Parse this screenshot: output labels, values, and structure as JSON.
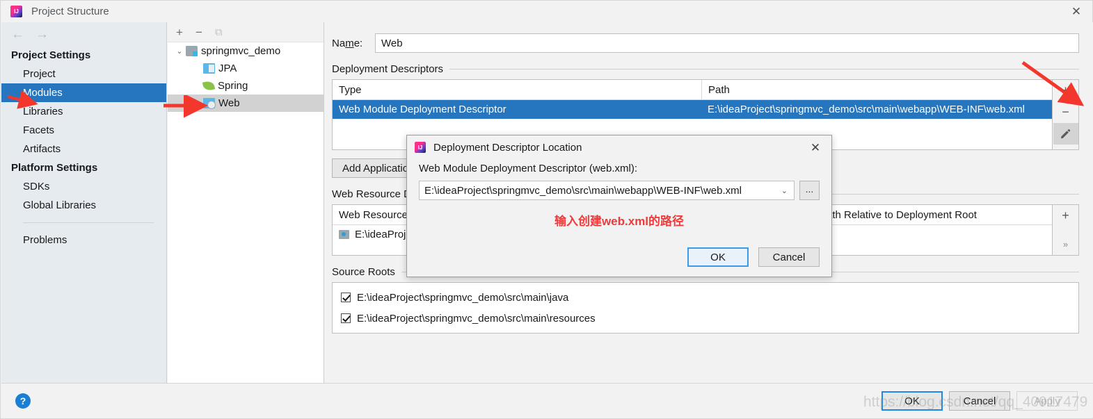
{
  "window": {
    "title": "Project Structure",
    "close_label": "✕",
    "app_icon": "intellij-idea-icon"
  },
  "sidebar": {
    "back_label": "←",
    "forward_label": "→",
    "groups": [
      {
        "label": "Project Settings",
        "items": [
          "Project",
          "Modules",
          "Libraries",
          "Facets",
          "Artifacts"
        ]
      },
      {
        "label": "Platform Settings",
        "items": [
          "SDKs",
          "Global Libraries"
        ]
      }
    ],
    "selected": "Modules",
    "problems_label": "Problems"
  },
  "tree_panel": {
    "toolbar": {
      "add": "+",
      "remove": "−",
      "copy": "⧉"
    },
    "nodes": [
      {
        "label": "springmvc_demo",
        "icon": "module-folder-icon",
        "indent": 0,
        "twisty": "⌄",
        "selected": false
      },
      {
        "label": "JPA",
        "icon": "jpa-facet-icon",
        "indent": 1,
        "twisty": "",
        "selected": false
      },
      {
        "label": "Spring",
        "icon": "spring-facet-icon",
        "indent": 1,
        "twisty": "",
        "selected": false
      },
      {
        "label": "Web",
        "icon": "web-facet-icon",
        "indent": 1,
        "twisty": "",
        "selected": true
      }
    ]
  },
  "main": {
    "name_label_pre": "Na",
    "name_label_accel": "m",
    "name_label_post": "e:",
    "name_value": "Web",
    "deployment": {
      "section_label": "Deployment Descriptors",
      "columns": [
        "Type",
        "Path"
      ],
      "rows": [
        {
          "type": "Web Module Deployment Descriptor",
          "path": "E:\\ideaProject\\springmvc_demo\\src\\main\\webapp\\WEB-INF\\web.xml",
          "selected": true
        }
      ],
      "side_buttons": [
        {
          "name": "add",
          "glyph": "+"
        },
        {
          "name": "remove",
          "glyph": "−"
        },
        {
          "name": "edit",
          "glyph": "✎"
        }
      ]
    },
    "add_application_button": "Add Application...",
    "web_resource": {
      "section_label": "Web Resource Directories",
      "columns": [
        "Web Resource Directory",
        "Path Relative to Deployment Root"
      ],
      "rows": [
        {
          "directory": "E:\\ideaProject\\springmvc_demo\\src\\main\\webapp",
          "relative": "/"
        }
      ],
      "side_buttons": [
        {
          "name": "add",
          "glyph": "+"
        },
        {
          "name": "more",
          "glyph": "»"
        }
      ]
    },
    "source_roots": {
      "section_label": "Source Roots",
      "rows": [
        {
          "path": "E:\\ideaProject\\springmvc_demo\\src\\main\\java",
          "checked": true
        },
        {
          "path": "E:\\ideaProject\\springmvc_demo\\src\\main\\resources",
          "checked": true
        }
      ]
    }
  },
  "modal": {
    "title": "Deployment Descriptor Location",
    "icon": "intellij-idea-icon",
    "close_label": "✕",
    "field_label": "Web Module Deployment Descriptor (web.xml):",
    "combo_value": "E:\\ideaProject\\springmvc_demo\\src\\main\\webapp\\WEB-INF\\web.xml",
    "combo_arrow": "⌄",
    "browse_label": "...",
    "annotation": "输入创建web.xml的路径",
    "ok_label": "OK",
    "cancel_label": "Cancel"
  },
  "footer": {
    "help_label": "?",
    "ok_label": "OK",
    "cancel_label": "Cancel",
    "apply_label": "Apply"
  },
  "watermark": "https://blog.csdn.net/qq_40917479",
  "colors": {
    "selection_blue": "#2675bf",
    "accent_blue": "#1f87e5",
    "annotation_red": "#ef3b3b",
    "window_bg": "#f2f2f2",
    "sidebar_bg": "#e6ebef"
  }
}
